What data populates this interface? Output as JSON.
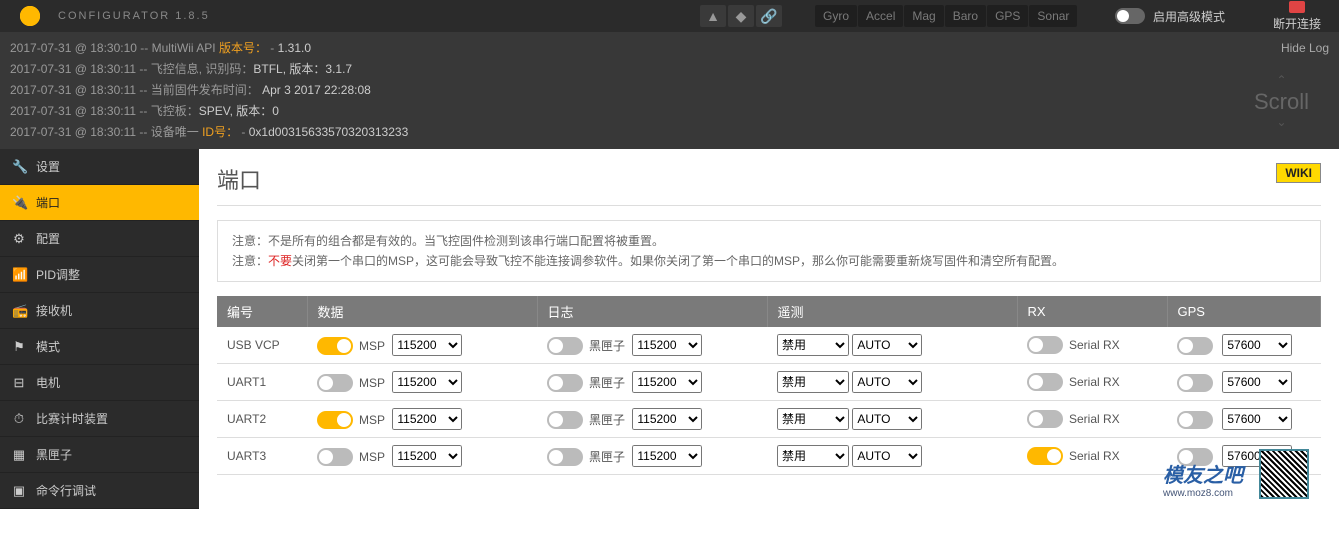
{
  "header": {
    "app_title": "CONFIGURATOR  1.8.5",
    "sensors": [
      "Gyro",
      "Accel",
      "Mag",
      "Baro",
      "GPS",
      "Sonar"
    ],
    "adv_mode_label": "启用高级模式",
    "disconnect_label": "断开连接"
  },
  "log": {
    "hide_label": "Hide Log",
    "scroll_label": "Scroll",
    "lines": [
      {
        "ts": "2017-07-31 @ 18:30:10",
        "pre": "MultiWii API ",
        "vk": "版本号：",
        "sep": " - ",
        "val": "1.31.0"
      },
      {
        "ts": "2017-07-31 @ 18:30:11",
        "pre": "飞控信息, 识别码：",
        "vk": "",
        "sep": "",
        "val": "BTFL, 版本：3.1.7"
      },
      {
        "ts": "2017-07-31 @ 18:30:11",
        "pre": "当前固件发布时间：",
        "vk": "",
        "sep": " ",
        "val": "Apr 3 2017 22:28:08"
      },
      {
        "ts": "2017-07-31 @ 18:30:11",
        "pre": "飞控板：",
        "vk": "",
        "sep": "",
        "val": "SPEV, 版本：0"
      },
      {
        "ts": "2017-07-31 @ 18:30:11",
        "pre": "设备唯一 ",
        "vk": "ID号：",
        "sep": " - ",
        "val": "0x1d00315633570320313233"
      }
    ]
  },
  "sidebar": {
    "items": [
      {
        "icon": "🔧",
        "label": "设置"
      },
      {
        "icon": "🔌",
        "label": "端口"
      },
      {
        "icon": "⚙",
        "label": "配置"
      },
      {
        "icon": "📶",
        "label": "PID调整"
      },
      {
        "icon": "📻",
        "label": "接收机"
      },
      {
        "icon": "⚑",
        "label": "模式"
      },
      {
        "icon": "⊟",
        "label": "电机"
      },
      {
        "icon": "⏱",
        "label": "比赛计时装置"
      },
      {
        "icon": "▦",
        "label": "黑匣子"
      },
      {
        "icon": "▣",
        "label": "命令行调试"
      }
    ],
    "active_index": 1
  },
  "page": {
    "title": "端口",
    "wiki": "WIKI",
    "note1": "注意：不是所有的组合都是有效的。当飞控固件检测到该串行端口配置将被重置。",
    "note2a": "注意：",
    "note2b": "不要",
    "note2c": "关闭第一个串口的MSP，这可能会导致飞控不能连接调参软件。如果你关闭了第一个串口的MSP，那么你可能需要重新烧写固件和清空所有配置。"
  },
  "table": {
    "headers": [
      "编号",
      "数据",
      "日志",
      "遥测",
      "RX",
      "GPS"
    ],
    "data_label": "MSP",
    "log_label": "黑匣子",
    "rx_label": "Serial RX",
    "baud_options": [
      "115200"
    ],
    "telem_options": [
      "禁用"
    ],
    "auto_options": [
      "AUTO"
    ],
    "gps_baud_options": [
      "57600"
    ],
    "rows": [
      {
        "id": "USB VCP",
        "msp_on": true,
        "baud": "115200",
        "log_on": false,
        "log_baud": "115200",
        "telem": "禁用",
        "telem_auto": "AUTO",
        "rx_on": false,
        "gps_on": false,
        "gps_baud": "57600"
      },
      {
        "id": "UART1",
        "msp_on": false,
        "baud": "115200",
        "log_on": false,
        "log_baud": "115200",
        "telem": "禁用",
        "telem_auto": "AUTO",
        "rx_on": false,
        "gps_on": false,
        "gps_baud": "57600"
      },
      {
        "id": "UART2",
        "msp_on": true,
        "baud": "115200",
        "log_on": false,
        "log_baud": "115200",
        "telem": "禁用",
        "telem_auto": "AUTO",
        "rx_on": false,
        "gps_on": false,
        "gps_baud": "57600"
      },
      {
        "id": "UART3",
        "msp_on": false,
        "baud": "115200",
        "log_on": false,
        "log_baud": "115200",
        "telem": "禁用",
        "telem_auto": "AUTO",
        "rx_on": true,
        "gps_on": false,
        "gps_baud": "57600"
      }
    ]
  },
  "footer": {
    "brand": "模友之吧",
    "url": "www.moz8.com"
  }
}
